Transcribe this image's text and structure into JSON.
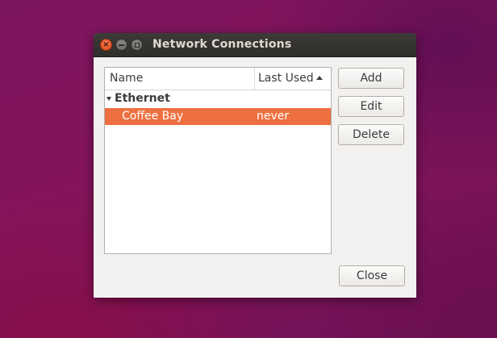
{
  "window": {
    "title": "Network Connections"
  },
  "titlebar_buttons": {
    "close": "×",
    "minimize": "",
    "maximize": ""
  },
  "list": {
    "columns": [
      "Name",
      "Last Used"
    ],
    "sort_column": "Last Used",
    "sort_direction": "ascending",
    "groups": [
      {
        "label": "Ethernet",
        "expanded": true,
        "connections": [
          {
            "name": "Coffee Bay",
            "last_used": "never",
            "selected": true
          }
        ]
      }
    ]
  },
  "buttons": {
    "add": "Add",
    "edit": "Edit",
    "delete": "Delete",
    "close": "Close"
  },
  "colors": {
    "selection": "#ee7040",
    "titlebar": "#3c3b37",
    "close_button": "#df4a16"
  }
}
